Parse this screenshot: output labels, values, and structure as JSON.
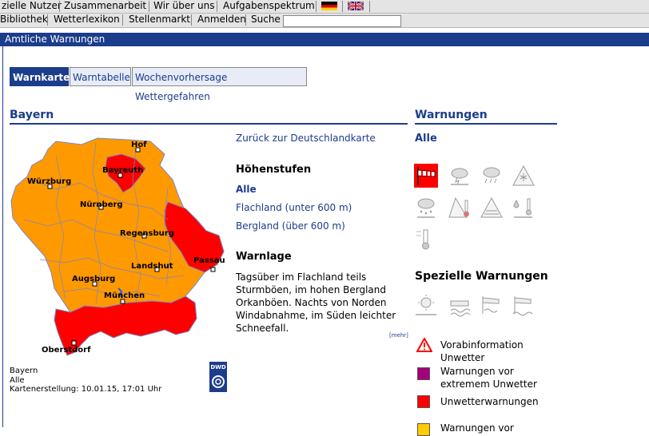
{
  "topnav": {
    "items": [
      "zielle Nutzer",
      "Zusammenarbeit",
      "Wir über uns",
      "Aufgabenspektrum"
    ],
    "items2": [
      "Bibliothek",
      "Wetterlexikon",
      "Stellenmarkt",
      "Anmelden",
      "Suche"
    ],
    "search_value": ""
  },
  "title": "Amtliche Warnungen",
  "tabs": [
    "Warnkarte",
    "Warntabelle",
    "Wochenvorhersage Wettergefahren"
  ],
  "map": {
    "heading": "Bayern",
    "cities": [
      "Hof",
      "Bayreuth",
      "Würzburg",
      "Nürnberg",
      "Regensburg",
      "Passau",
      "Landshut",
      "Augsburg",
      "München",
      "Oberstdorf"
    ],
    "caption": [
      "Bayern",
      "Alle",
      "Kartenerstellung: 10.01.15, 17:01 Uhr"
    ],
    "logo_text": "DWD"
  },
  "middle": {
    "back_link": "Zurück zur Deutschlandkarte",
    "hoehen_title": "Höhenstufen",
    "hoehen_all": "Alle",
    "hoehen_flach": "Flachland (unter 600 m)",
    "hoehen_berg": "Bergland (über 600 m)",
    "warnlage_title": "Warnlage",
    "warnlage_text": [
      "Tagsüber im Flachland teils",
      "Sturmböen, im hohen Bergland",
      "Orkanböen. Nachts von Norden",
      "Windabnahme, im Süden leichter",
      "Schneefall."
    ],
    "mehr": "[mehr]"
  },
  "right": {
    "heading": "Warnungen",
    "all": "Alle",
    "special_title": "Spezielle Warnungen",
    "legend": [
      {
        "label": [
          "Vorabinformation",
          "Unwetter"
        ],
        "color": "#ffffff"
      },
      {
        "label": [
          "Warnungen vor",
          "extremem Unwetter"
        ],
        "color": "#a4007a"
      },
      {
        "label": [
          "Unwetterwarnungen"
        ],
        "color": "#ff0000"
      },
      {
        "label": [
          "Warnungen vor"
        ],
        "color": "#ffcc00"
      }
    ]
  },
  "colors": {
    "accent": "#1c3c8c",
    "orange": "#ff9900",
    "red": "#ff0000"
  }
}
